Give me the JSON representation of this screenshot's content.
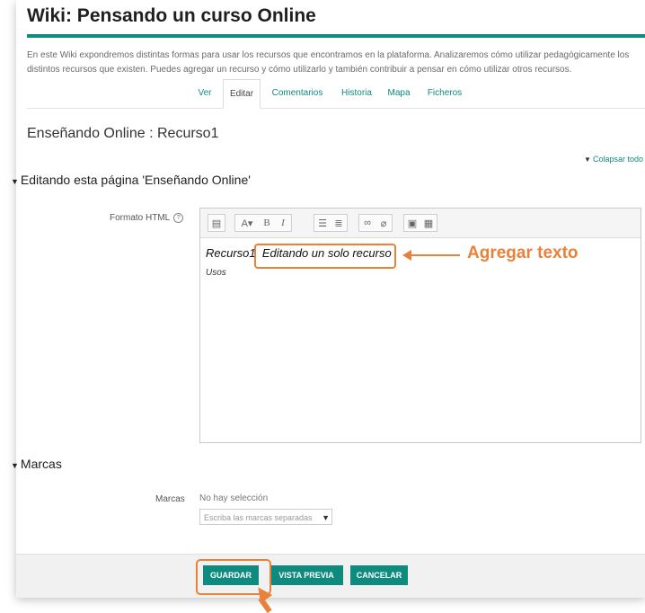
{
  "header": {
    "title": "Wiki: Pensando un curso Online",
    "description": "En este Wiki expondremos distintas formas para usar los recursos que encontramos en la plataforma. Analizaremos cómo utilizar pedagógicamente los distintos recursos que existen. Puedes agregar un recurso y cómo utilizarlo y también contribuir a pensar en cómo utilizar otros recursos."
  },
  "tabs": [
    {
      "label": "Ver",
      "active": false
    },
    {
      "label": "Editar",
      "active": true
    },
    {
      "label": "Comentarios",
      "active": false
    },
    {
      "label": "Historia",
      "active": false
    },
    {
      "label": "Mapa",
      "active": false
    },
    {
      "label": "Ficheros",
      "active": false
    }
  ],
  "page": {
    "heading": "Enseñando Online : Recurso1",
    "collapse_all": "Colapsar todo"
  },
  "edit_section": {
    "title": "Editando esta página 'Enseñando Online'",
    "format_label": "Formato HTML",
    "editor_line1_prefix": "Recurso1",
    "editor_line1_highlight": "Editando un solo recurso",
    "editor_line2": "Usos",
    "toolbar_icons": [
      "table-icon",
      "font-color-icon",
      "bold-icon",
      "italic-icon",
      "bullet-list-icon",
      "numbered-list-icon",
      "link-icon",
      "unlink-icon",
      "image-icon",
      "media-icon"
    ]
  },
  "annotation": {
    "callout_text": "Agregar texto",
    "accent_color": "#e8813a"
  },
  "tags_section": {
    "title": "Marcas",
    "label": "Marcas",
    "current_value": "No hay selección",
    "input_placeholder": "Escriba las marcas separadas"
  },
  "buttons": {
    "save": "GUARDAR",
    "preview": "VISTA PREVIA",
    "cancel": "CANCELAR"
  },
  "colors": {
    "brand": "#0f8a7e"
  }
}
